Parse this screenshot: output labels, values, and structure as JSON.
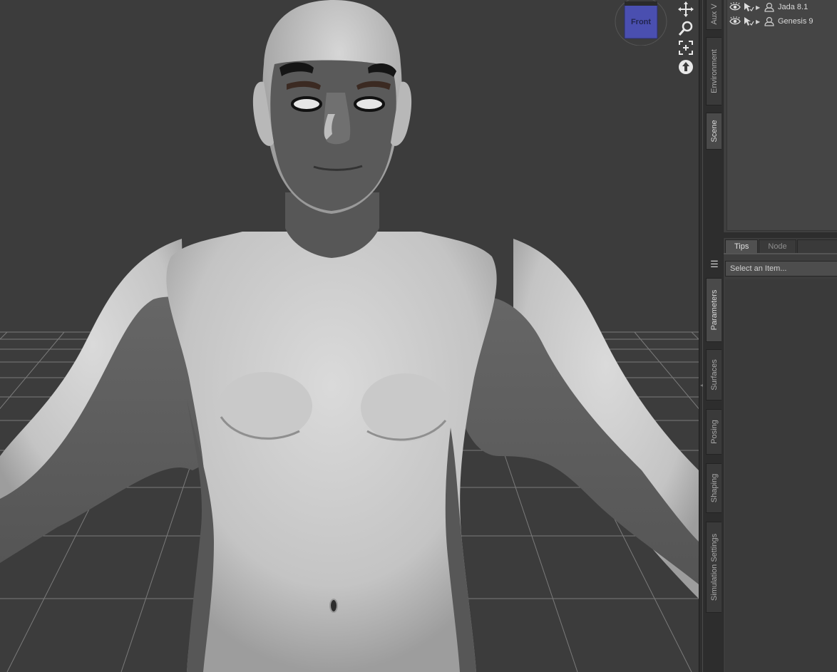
{
  "viewport": {
    "view_cube_label": "Front",
    "tools": [
      {
        "name": "pan-tool-icon"
      },
      {
        "name": "zoom-tool-icon"
      },
      {
        "name": "frame-tool-icon"
      },
      {
        "name": "orbit-tool-icon"
      }
    ]
  },
  "side_tabs": {
    "top": [
      {
        "label": "Aux V"
      },
      {
        "label": "Environment"
      },
      {
        "label": "Scene"
      }
    ],
    "bottom": [
      {
        "label": "Parameters"
      },
      {
        "label": "Surfaces"
      },
      {
        "label": "Posing"
      },
      {
        "label": "Shaping"
      },
      {
        "label": "Simulation Settings"
      }
    ]
  },
  "scene": {
    "items": [
      {
        "label": "Jada 8.1"
      },
      {
        "label": "Genesis 9"
      }
    ]
  },
  "lower_panel": {
    "tabs": [
      {
        "label": "Tips"
      },
      {
        "label": "Node"
      }
    ],
    "select_placeholder": "Select an Item..."
  },
  "colors": {
    "viewport_bg": "#3c3c3c",
    "grid": "#8a8a8a",
    "skin_light": "#cfcfcf",
    "skin_dark": "#5e5e5e",
    "view_cube": "#4a4fb0"
  }
}
